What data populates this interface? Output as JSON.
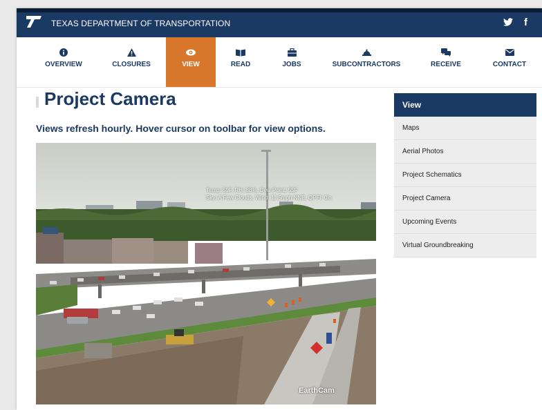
{
  "header": {
    "brand": "TEXAS DEPARTMENT OF TRANSPORTATION",
    "social": [
      {
        "name": "twitter-icon",
        "glyph": "🐦"
      },
      {
        "name": "facebook-icon",
        "glyph": "f"
      }
    ]
  },
  "nav": {
    "items": [
      {
        "label": "OVERVIEW",
        "icon": "info-icon"
      },
      {
        "label": "CLOSURES",
        "icon": "warning-icon"
      },
      {
        "label": "VIEW",
        "icon": "eye-icon",
        "active": true
      },
      {
        "label": "READ",
        "icon": "book-icon"
      },
      {
        "label": "JOBS",
        "icon": "briefcase-icon"
      },
      {
        "label": "SUBCONTRACTORS",
        "icon": "hardhat-icon"
      },
      {
        "label": "RECEIVE",
        "icon": "chat-icon"
      },
      {
        "label": "CONTACT",
        "icon": "envelope-icon"
      }
    ],
    "active_color": "#d8772c"
  },
  "main": {
    "title": "Project Camera",
    "subtitle": "Views refresh hourly. Hover cursor on toolbar for view options.",
    "camera": {
      "overlay_line1": "Temp: 59F, RH: 88%, Dew Point: 55F",
      "overlay_line2": "Sky: A Few Clouds, Wind: 11.5mph NNE, QPFI: 0in",
      "watermark": "EarthCam"
    }
  },
  "sidebar": {
    "heading": "View",
    "items": [
      "Maps",
      "Aerial Photos",
      "Project Schematics",
      "Project Camera",
      "Upcoming Events",
      "Virtual Groundbreaking"
    ]
  },
  "colors": {
    "brand_navy": "#1b3a63",
    "accent_orange": "#d8772c"
  }
}
